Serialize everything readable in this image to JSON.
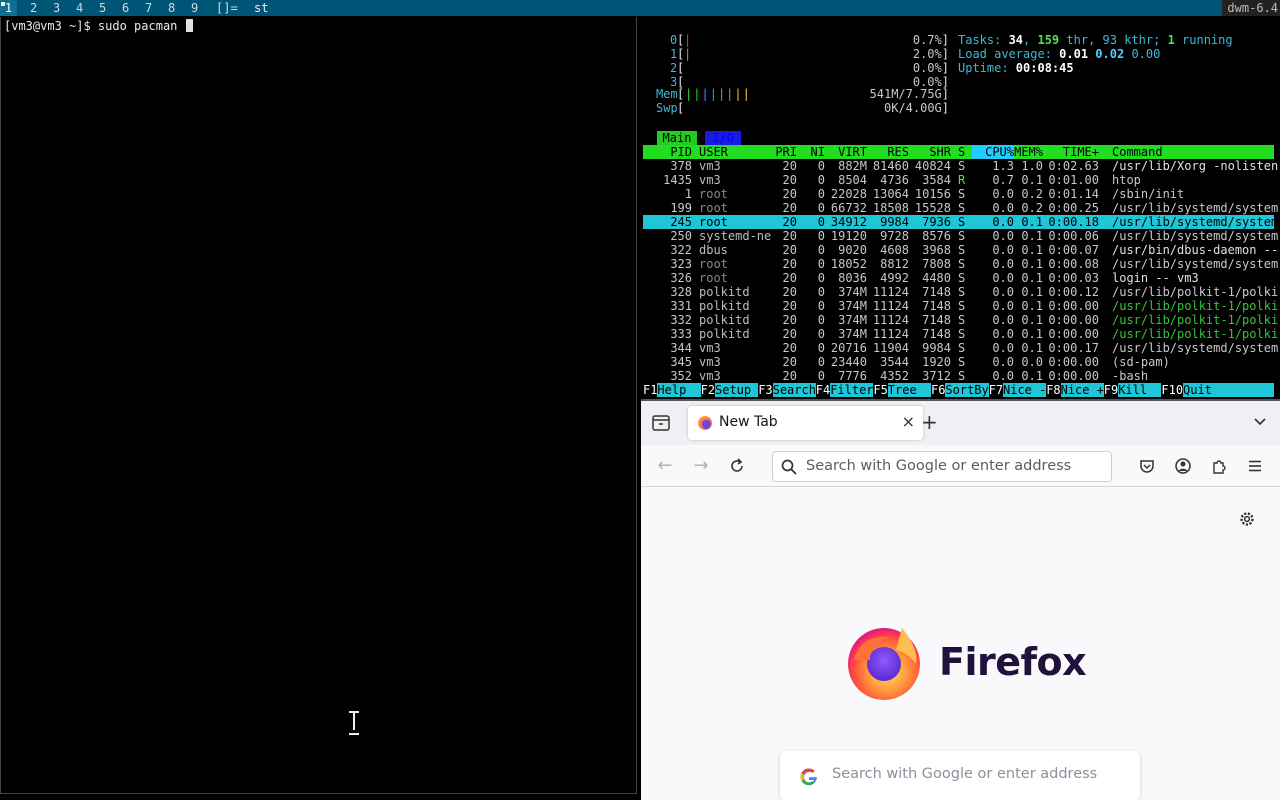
{
  "bar": {
    "tags": [
      "1",
      "2",
      "3",
      "4",
      "5",
      "6",
      "7",
      "8",
      "9"
    ],
    "selected_tag": "1",
    "layout": "[]=",
    "title": "st",
    "status": "dwm-6.4"
  },
  "terminal": {
    "prompt": "[vm3@vm3 ~]$ sudo pacman "
  },
  "htop": {
    "cpus": [
      {
        "num": "0",
        "val": "0.7%",
        "bar": "|",
        "bar_color": "#e33"
      },
      {
        "num": "1",
        "val": "2.0%",
        "bar": "|",
        "bar_color": "#3c3"
      },
      {
        "num": "2",
        "val": "0.0%",
        "bar": "",
        "bar_color": "#3c3"
      },
      {
        "num": "3",
        "val": "0.0%",
        "bar": "",
        "bar_color": "#3c3"
      }
    ],
    "mem": {
      "label": "Mem",
      "bar": "||||||||",
      "val": "541M/7.75G"
    },
    "swp": {
      "label": "Swp",
      "bar": "",
      "val": "0K/4.00G"
    },
    "tasks_label": "Tasks: ",
    "tasks": "34",
    "thr": "159",
    "thr_label": " thr, ",
    "kthr": "93",
    "kthr_label": " kthr; ",
    "running": "1",
    "running_label": " running",
    "load_label": "Load average: ",
    "load1": "0.01",
    "load5": "0.02",
    "load15": "0.00",
    "uptime_label": "Uptime: ",
    "uptime": "00:08:45",
    "tab_main": "Main",
    "tab_io": "I/O",
    "columns": {
      "pid": "PID",
      "user": "USER",
      "pri": "PRI",
      "ni": "NI",
      "virt": "VIRT",
      "res": "RES",
      "shr": "SHR",
      "s": "S",
      "cpu": "CPU%",
      "mem": "MEM%",
      "time": "TIME+",
      "cmd": "Command"
    },
    "processes": [
      {
        "pid": "378",
        "user": "vm3",
        "pri": "20",
        "ni": "0",
        "virt": "882M",
        "res": "81460",
        "shr": "40824",
        "s": "S",
        "cpu": "1.3",
        "mem": "1.0",
        "time": "0:02.63",
        "cmd": "/usr/lib/Xorg -nolisten"
      },
      {
        "pid": "1435",
        "user": "vm3",
        "pri": "20",
        "ni": "0",
        "virt": "8504",
        "res": "4736",
        "shr": "3584",
        "s": "R",
        "cpu": "0.7",
        "mem": "0.1",
        "time": "0:01.00",
        "cmd": "htop"
      },
      {
        "pid": "1",
        "user": "root",
        "pri": "20",
        "ni": "0",
        "virt": "22028",
        "res": "13064",
        "shr": "10156",
        "s": "S",
        "cpu": "0.0",
        "mem": "0.2",
        "time": "0:01.14",
        "cmd": "/sbin/init"
      },
      {
        "pid": "199",
        "user": "root",
        "pri": "20",
        "ni": "0",
        "virt": "66732",
        "res": "18508",
        "shr": "15528",
        "s": "S",
        "cpu": "0.0",
        "mem": "0.2",
        "time": "0:00.25",
        "cmd": "/usr/lib/systemd/system"
      },
      {
        "pid": "245",
        "user": "root",
        "pri": "20",
        "ni": "0",
        "virt": "34912",
        "res": "9984",
        "shr": "7936",
        "s": "S",
        "cpu": "0.0",
        "mem": "0.1",
        "time": "0:00.18",
        "cmd": "/usr/lib/systemd/system"
      },
      {
        "pid": "250",
        "user": "systemd-ne",
        "pri": "20",
        "ni": "0",
        "virt": "19120",
        "res": "9728",
        "shr": "8576",
        "s": "S",
        "cpu": "0.0",
        "mem": "0.1",
        "time": "0:00.06",
        "cmd": "/usr/lib/systemd/system"
      },
      {
        "pid": "322",
        "user": "dbus",
        "pri": "20",
        "ni": "0",
        "virt": "9020",
        "res": "4608",
        "shr": "3968",
        "s": "S",
        "cpu": "0.0",
        "mem": "0.1",
        "time": "0:00.07",
        "cmd": "/usr/bin/dbus-daemon --"
      },
      {
        "pid": "323",
        "user": "root",
        "pri": "20",
        "ni": "0",
        "virt": "18052",
        "res": "8812",
        "shr": "7808",
        "s": "S",
        "cpu": "0.0",
        "mem": "0.1",
        "time": "0:00.08",
        "cmd": "/usr/lib/systemd/system"
      },
      {
        "pid": "326",
        "user": "root",
        "pri": "20",
        "ni": "0",
        "virt": "8036",
        "res": "4992",
        "shr": "4480",
        "s": "S",
        "cpu": "0.0",
        "mem": "0.1",
        "time": "0:00.03",
        "cmd": "login -- vm3"
      },
      {
        "pid": "328",
        "user": "polkitd",
        "pri": "20",
        "ni": "0",
        "virt": "374M",
        "res": "11124",
        "shr": "7148",
        "s": "S",
        "cpu": "0.0",
        "mem": "0.1",
        "time": "0:00.12",
        "cmd": "/usr/lib/polkit-1/polki"
      },
      {
        "pid": "331",
        "user": "polkitd",
        "pri": "20",
        "ni": "0",
        "virt": "374M",
        "res": "11124",
        "shr": "7148",
        "s": "S",
        "cpu": "0.0",
        "mem": "0.1",
        "time": "0:00.00",
        "cmd": "/usr/lib/polkit-1/polki"
      },
      {
        "pid": "332",
        "user": "polkitd",
        "pri": "20",
        "ni": "0",
        "virt": "374M",
        "res": "11124",
        "shr": "7148",
        "s": "S",
        "cpu": "0.0",
        "mem": "0.1",
        "time": "0:00.00",
        "cmd": "/usr/lib/polkit-1/polki"
      },
      {
        "pid": "333",
        "user": "polkitd",
        "pri": "20",
        "ni": "0",
        "virt": "374M",
        "res": "11124",
        "shr": "7148",
        "s": "S",
        "cpu": "0.0",
        "mem": "0.1",
        "time": "0:00.00",
        "cmd": "/usr/lib/polkit-1/polki"
      },
      {
        "pid": "344",
        "user": "vm3",
        "pri": "20",
        "ni": "0",
        "virt": "20716",
        "res": "11904",
        "shr": "9984",
        "s": "S",
        "cpu": "0.0",
        "mem": "0.1",
        "time": "0:00.17",
        "cmd": "/usr/lib/systemd/system"
      },
      {
        "pid": "345",
        "user": "vm3",
        "pri": "20",
        "ni": "0",
        "virt": "23440",
        "res": "3544",
        "shr": "1920",
        "s": "S",
        "cpu": "0.0",
        "mem": "0.0",
        "time": "0:00.00",
        "cmd": "(sd-pam)"
      },
      {
        "pid": "352",
        "user": "vm3",
        "pri": "20",
        "ni": "0",
        "virt": "7776",
        "res": "4352",
        "shr": "3712",
        "s": "S",
        "cpu": "0.0",
        "mem": "0.1",
        "time": "0:00.00",
        "cmd": "-bash"
      }
    ],
    "selected_pid": "245",
    "thread_pids": [
      "331",
      "332",
      "333"
    ],
    "fkeys": [
      {
        "key": "F1",
        "label": "Help  "
      },
      {
        "key": "F2",
        "label": "Setup "
      },
      {
        "key": "F3",
        "label": "Search"
      },
      {
        "key": "F4",
        "label": "Filter"
      },
      {
        "key": "F5",
        "label": "Tree  "
      },
      {
        "key": "F6",
        "label": "SortBy"
      },
      {
        "key": "F7",
        "label": "Nice -"
      },
      {
        "key": "F8",
        "label": "Nice +"
      },
      {
        "key": "F9",
        "label": "Kill  "
      },
      {
        "key": "F10",
        "label": "Quit"
      }
    ]
  },
  "firefox": {
    "tab_title": "New Tab",
    "tab_close": "×",
    "new_tab": "+",
    "url_placeholder": "Search with Google or enter address",
    "wordmark": "Firefox",
    "search_placeholder": "Search with Google or enter address",
    "accent": "#0060df"
  }
}
